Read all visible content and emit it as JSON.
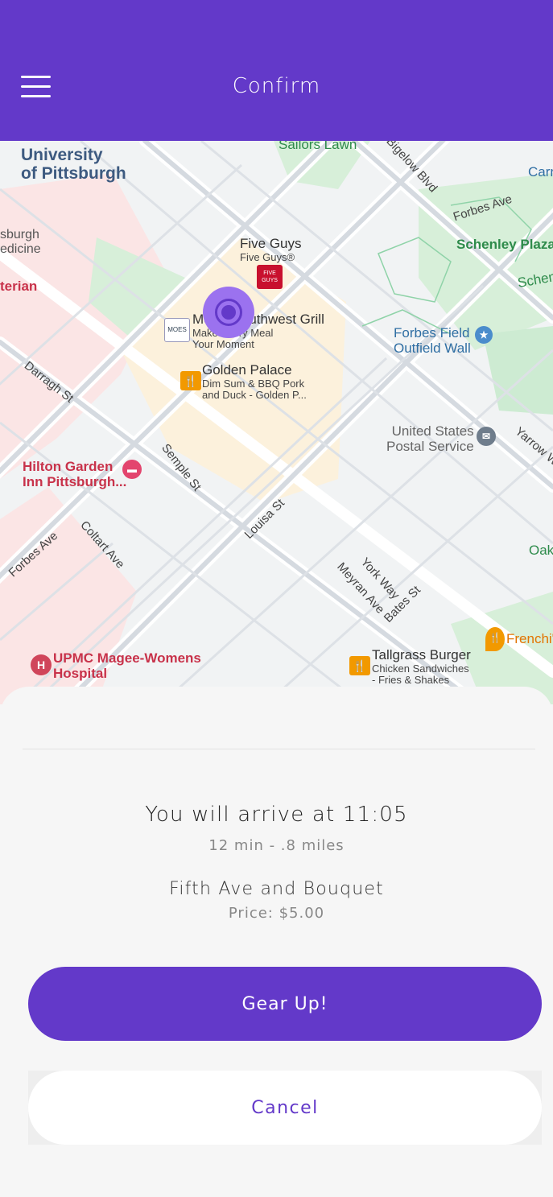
{
  "header": {
    "title": "Confirm",
    "menu_icon": "hamburger-menu-icon"
  },
  "map": {
    "labels": {
      "university": "University\nof Pittsburgh",
      "sailors_lawn": "Sailors Lawn",
      "bigelow": "Bigelow Blvd",
      "carr": "Carr",
      "forbes_ave_top": "Forbes Ave",
      "schenley_plaza": "Schenley Plaza",
      "schenley": "Schen",
      "upmc_medicine": "sburgh\nedicine",
      "veterian": "terian",
      "five_guys": "Five Guys",
      "five_guys_sub": "Five Guys®",
      "moes": "Moe's Southwest Grill",
      "moes_sub": "Make Every Meal\nYour Moment",
      "forbes_field": "Forbes Field\nOutfield Wall",
      "darragh": "Darragh St",
      "golden_palace": "Golden Palace",
      "golden_palace_sub": "Dim Sum & BBQ Pork\nand Duck - Golden P...",
      "usps": "United States\nPostal Service",
      "yarrow": "Yarrow W",
      "hilton": "Hilton Garden\nInn Pittsburgh...",
      "semple": "Semple St",
      "forbes_ave_left": "Forbes Ave",
      "coltart": "Coltart Ave",
      "louisa": "Louisa St",
      "york": "York Way",
      "meyran": "Meyran Ave",
      "bates": "Bates St",
      "oak": "Oak",
      "upmc_magee": "UPMC Magee-Womens\nHospital",
      "tallgrass": "Tallgrass Burger",
      "tallgrass_sub": "Chicken Sandwiches\n- Fries & Shakes",
      "frenchi": "Frenchi'",
      "five_guys_logo": "FIVE\nGUYS",
      "moes_logo": "MOES",
      "hospital_h": "H"
    }
  },
  "trip": {
    "arrival": "You will arrive at 11:05",
    "eta": "12 min - .8 miles",
    "destination": "Fifth Ave and Bouquet",
    "price": "Price: $5.00"
  },
  "actions": {
    "confirm_label": "Gear Up!",
    "cancel_label": "Cancel"
  },
  "colors": {
    "accent": "#6339c9",
    "pin": "#9b72ef"
  }
}
